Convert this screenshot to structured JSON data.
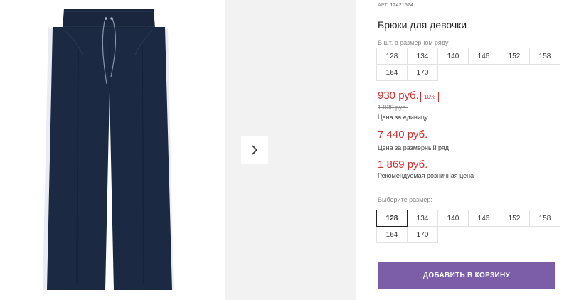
{
  "product": {
    "article_label": "АРТ.",
    "article_code": "12421574",
    "title": "Брюки для девочки"
  },
  "pack_sizes": {
    "label": "В шт. в размерном ряду",
    "items": [
      "128",
      "134",
      "140",
      "146",
      "152",
      "158",
      "164",
      "170"
    ]
  },
  "pricing": {
    "unit_price": "930 руб.",
    "discount": "10%",
    "old_price": "1 030 руб.",
    "unit_caption": "Цена за единицу",
    "row_price": "7 440 руб.",
    "row_caption": "Цена за размерный ряд",
    "retail_price": "1 869 руб.",
    "retail_caption": "Рекомендуемая розничная цена"
  },
  "size_select": {
    "label": "Выберите размер:",
    "selected": "128",
    "items": [
      "128",
      "134",
      "140",
      "146",
      "152",
      "158",
      "164",
      "170"
    ]
  },
  "actions": {
    "add_to_cart": "ДОБАВИТЬ В КОРЗИНУ",
    "next_icon": "chevron-right-icon"
  },
  "colors": {
    "price_red": "#d32f2f",
    "button_purple": "#7b5ea7",
    "pants_navy": "#1c2942"
  }
}
